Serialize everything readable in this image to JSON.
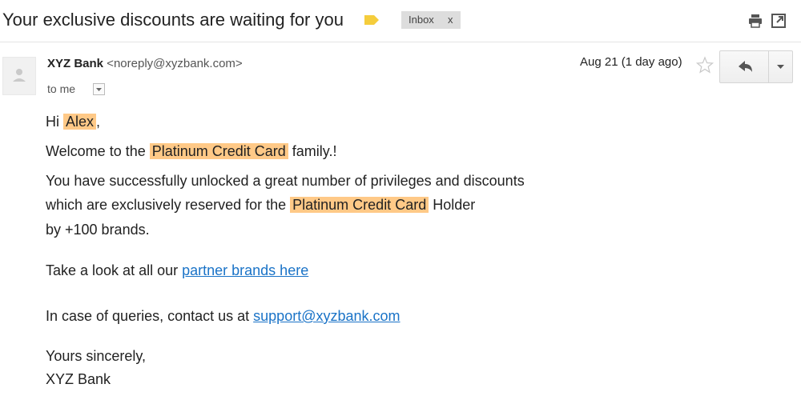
{
  "email": {
    "subject": "Your exclusive discounts are waiting for you",
    "label": "Inbox",
    "label_remove": "x",
    "sender_name": "XYZ Bank",
    "sender_email": "<noreply@xyzbank.com>",
    "recipient": "to me",
    "date": "Aug 21 (1 day ago)"
  },
  "body": {
    "greeting_prefix": "Hi ",
    "greeting_name": "Alex",
    "greeting_suffix": ",",
    "welcome_prefix": "Welcome to the ",
    "card_name": "Platinum Credit Card",
    "welcome_suffix": " family.!",
    "para1_line1": "You have successfully unlocked a great number of privileges and discounts",
    "para1_line2_prefix": "which are exclusively reserved for the ",
    "para1_line2_suffix": " Holder",
    "para1_line3": "by +100 brands.",
    "partner_prefix": "Take a look at all our ",
    "partner_link": "partner brands here",
    "contact_prefix": "In case of queries, contact us at ",
    "contact_link": "support@xyzbank.com ",
    "closing": "Yours sincerely,",
    "signature": "XYZ Bank"
  },
  "colors": {
    "highlight": "#ffc987",
    "link": "#1a73c7",
    "label_tag": "#f5cd3c"
  },
  "icons": [
    "label-tag-icon",
    "print-icon",
    "new-window-icon",
    "avatar-person-icon",
    "dropdown-arrow-icon",
    "star-icon",
    "reply-arrow-icon",
    "chevron-down-icon"
  ]
}
